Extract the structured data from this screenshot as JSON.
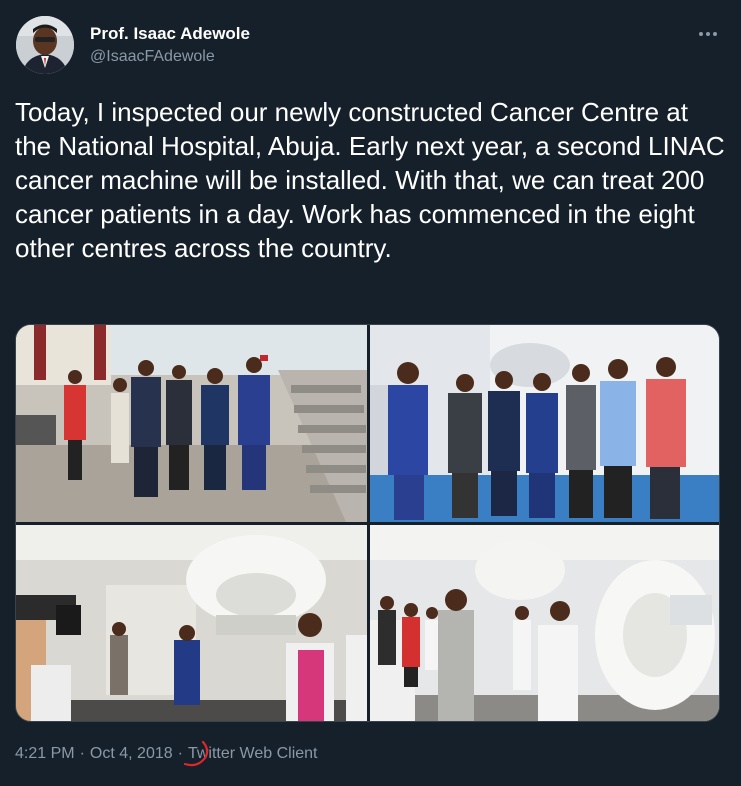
{
  "author": {
    "display_name": "Prof. Isaac Adewole",
    "handle": "@IsaacFAdewole"
  },
  "tweet": {
    "text": "Today, I inspected our newly constructed Cancer Centre at the National Hospital, Abuja. Early next year, a second LINAC cancer machine will be installed. With that, we can treat 200 cancer patients in a day. Work has commenced in the eight other centres across the country."
  },
  "meta": {
    "time": "4:21 PM",
    "separator": "·",
    "date": "Oct 4, 2018",
    "client": "Twitter Web Client"
  },
  "icons": {
    "more": "more-options-icon"
  },
  "colors": {
    "background": "#15202b",
    "text": "#ffffff",
    "secondary": "#8b98a5",
    "annotation": "#e0262b"
  }
}
